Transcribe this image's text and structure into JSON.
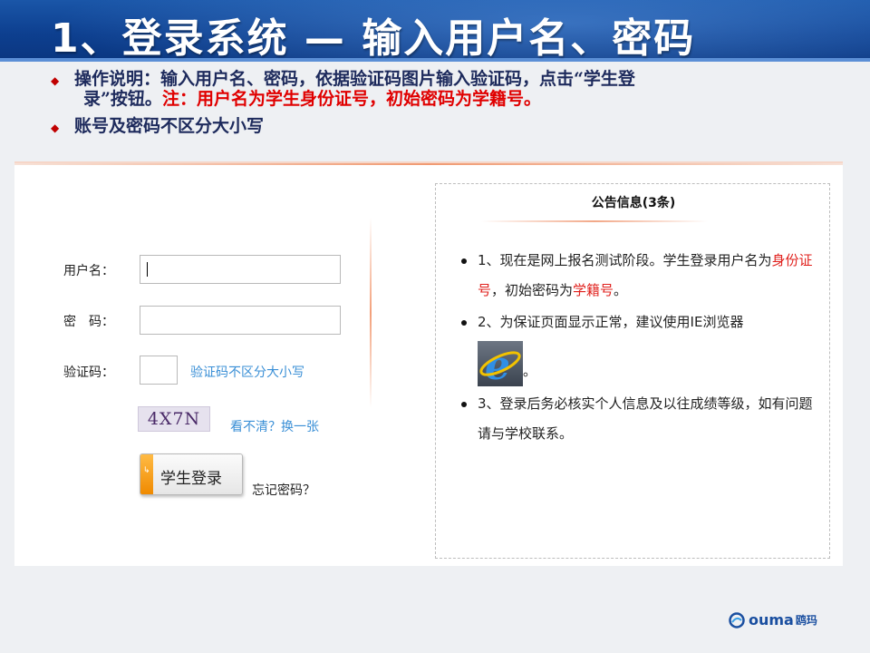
{
  "header": {
    "title": "1、登录系统 — 输入用户名、密码"
  },
  "instructions": {
    "line1_text": "操作说明：输入用户名、密码，依据验证码图片输入验证码，点击“学生登",
    "line1_cont": "录”按钮。",
    "line1_note": "注：用户名为学生身份证号，初始密码为学籍号。",
    "line2_text": "账号及密码不区分大小写"
  },
  "login": {
    "username_label": "用户名：",
    "username_value": "",
    "password_label": "密　码：",
    "password_value": "",
    "captcha_label": "验证码：",
    "captcha_value": "",
    "captcha_hint": "验证码不区分大小写",
    "captcha_text": "4X7N",
    "refresh_link": "看不清？换一张",
    "login_button": "学生登录",
    "forgot_link": "忘记密码？"
  },
  "notice": {
    "title": "公告信息(3条)",
    "item1_a": "1、现在是网上报名测试阶段。学生登录用户名为",
    "item1_red1": "身份证号",
    "item1_b": "，初始密码为",
    "item1_red2": "学籍号",
    "item1_c": "。",
    "item2_a": "2、为保证页面显示正常，建议使用IE浏览器",
    "item2_b": "。",
    "item3": "3、登录后务必核实个人信息及以往成绩等级，如有问题请与学校联系。"
  },
  "logo": {
    "brand": "ouma",
    "cn": "鸥玛"
  },
  "colors": {
    "banner": "#0d3f8f",
    "note_red": "#e00000",
    "link_blue": "#3a8fd6",
    "button_tab": "#f08a00"
  },
  "icons": [
    "bullet-diamond-icon",
    "ie-browser-icon",
    "ouma-logo-icon",
    "button-tab-icon"
  ]
}
